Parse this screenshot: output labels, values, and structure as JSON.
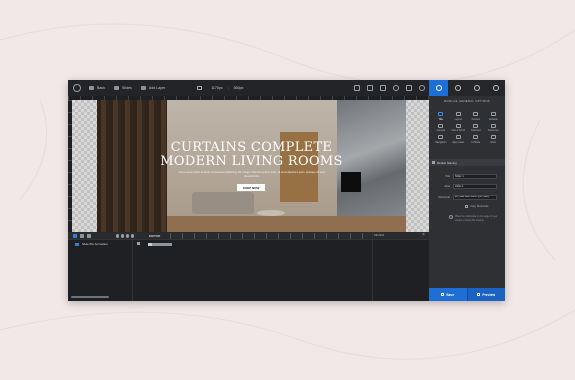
{
  "toolbar": {
    "back_label": "Back",
    "slides_label": "Slides",
    "add_layer_label": "Add Layer",
    "width_value": "1170px",
    "height_value": "560px"
  },
  "slide": {
    "headline_line1": "CURTAINS COMPLETE",
    "headline_line2": "MODERN LIVING ROOMS",
    "subtext": "Lorem ipsum dolor sit amet, consectetur adipiscing elit. Integer vitae fermentum dolor, sit amet dignissim justo. Quisque sit amet pharetra felis.",
    "button_label": "SHOP NOW"
  },
  "timeline": {
    "editor_label": "EDITOR",
    "layer_name": "Slide BG Animation",
    "right_label": "REVIEW"
  },
  "panel": {
    "title": "MODULE GENERAL OPTIONS",
    "grid": [
      {
        "label": "Title",
        "active": true
      },
      {
        "label": "Layout",
        "active": false
      },
      {
        "label": "Content",
        "active": false
      },
      {
        "label": "Defaults",
        "active": false
      },
      {
        "label": "General",
        "active": false
      },
      {
        "label": "Nav & Scroll",
        "active": false
      },
      {
        "label": "Carousel",
        "active": false
      },
      {
        "label": "Advanced",
        "active": false
      },
      {
        "label": "Navigation",
        "active": false
      },
      {
        "label": "Ajax Loads",
        "active": false
      },
      {
        "label": "Ar Mode",
        "active": false
      },
      {
        "label": "More",
        "active": false
      }
    ],
    "section_label": "Module Naming",
    "title_label": "Title",
    "title_value": "Slider 1",
    "alias_label": "Alias",
    "alias_value": "slider-1",
    "shortcode_label": "Shortcode",
    "shortcode_value": "[rev_slider alias=\"slider-1\"][/rev_slider]",
    "copy_label": "Copy Shortcode",
    "note": "Place the shortcode on the page of your choice to show this module.",
    "save_label": "Save",
    "preview_label": "Preview"
  }
}
